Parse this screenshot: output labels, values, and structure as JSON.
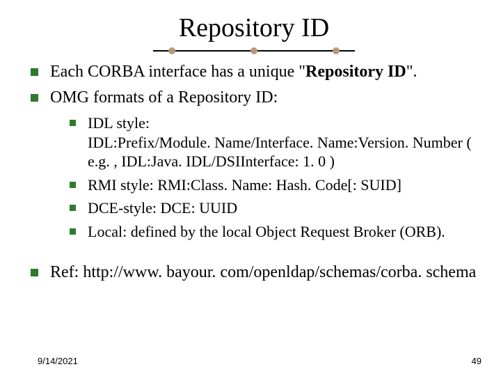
{
  "title": "Repository ID",
  "bullets": {
    "b1": "Each CORBA interface has a unique \"",
    "b1_bold": "Repository ID",
    "b1_tail": "\".",
    "b2": "OMG formats of a Repository ID:",
    "sub": {
      "s1a": "IDL style:",
      "s1b": "IDL:Prefix/Module. Name/Interface. Name:Version. Number ( e.g. , IDL:Java. IDL/DSIInterface: 1. 0 )",
      "s2": "RMI style:        RMI:Class. Name: Hash. Code[: SUID]",
      "s3": "DCE-style:        DCE: UUID",
      "s4": "Local:    defined by the local Object Request Broker (ORB)."
    },
    "ref": "Ref: http://www. bayour. com/openldap/schemas/corba. schema"
  },
  "footer": {
    "date": "9/14/2021",
    "page": "49"
  }
}
